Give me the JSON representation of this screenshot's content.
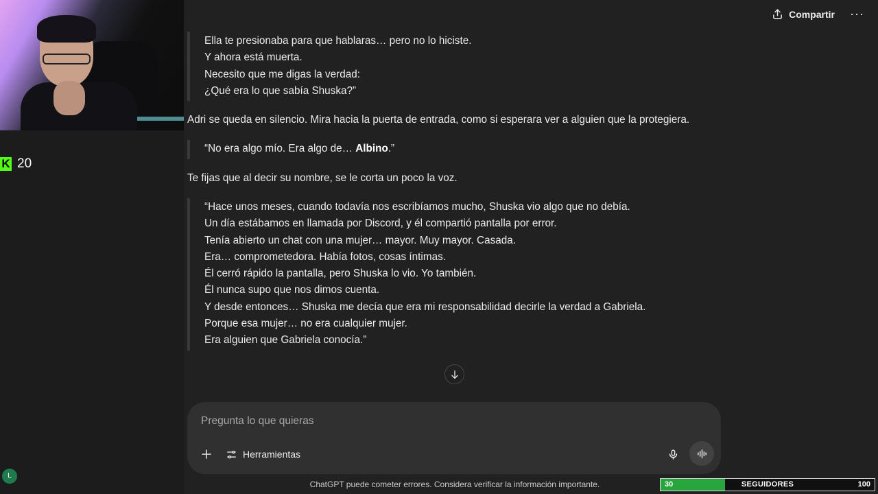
{
  "stream": {
    "kick_count": "20",
    "avatar_initial": "L",
    "followers": {
      "min": "30",
      "label": "SEGUIDORES",
      "max": "100",
      "progress_fraction": 0.3
    }
  },
  "header": {
    "share_label": "Compartir",
    "more_label": "···"
  },
  "chat": {
    "quote1": [
      "Ella te presionaba para que hablaras… pero no lo hiciste.",
      "Y ahora está muerta.",
      "Necesito que me digas la verdad:",
      "¿Qué era lo que sabía Shuska?”"
    ],
    "para1": "Adri se queda en silencio. Mira hacia la puerta de entrada, como si esperara ver a alguien que la protegiera.",
    "quote2": {
      "before": "“No era algo mío. Era algo de… ",
      "bold": "Albino",
      "after": ".”"
    },
    "para2": "Te fijas que al decir su nombre, se le corta un poco la voz.",
    "quote3": [
      "“Hace unos meses, cuando todavía nos escribíamos mucho, Shuska vio algo que no debía.",
      "Un día estábamos en llamada por Discord, y él compartió pantalla por error.",
      "Tenía abierto un chat con una mujer… mayor. Muy mayor. Casada.",
      "Era… comprometedora. Había fotos, cosas íntimas.",
      "Él cerró rápido la pantalla, pero Shuska lo vio. Yo también.",
      "Él nunca supo que nos dimos cuenta.",
      "Y desde entonces… Shuska me decía que era mi responsabilidad decirle la verdad a Gabriela.",
      "Porque esa mujer… no era cualquier mujer.",
      "Era alguien que Gabriela conocía.”"
    ]
  },
  "composer": {
    "placeholder": "Pregunta lo que quieras",
    "tools_label": "Herramientas"
  },
  "footer": {
    "note": "ChatGPT puede cometer errores. Considera verificar la información importante."
  },
  "colors": {
    "kick_green": "#53fc18",
    "follower_bar": "#27a63e",
    "background": "#212121"
  }
}
